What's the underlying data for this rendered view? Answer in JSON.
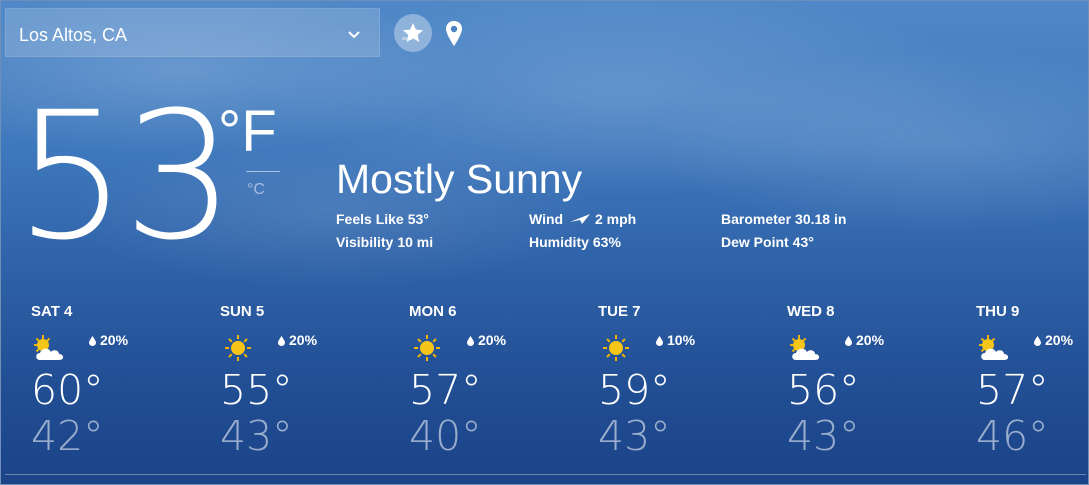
{
  "header": {
    "location": "Los Altos, CA",
    "icons": {
      "dropdown": "chevron-down-icon",
      "favorite": "favorite-star-icon",
      "current_location": "location-pin-icon"
    }
  },
  "current": {
    "temperature": "53",
    "unit_active": "°F",
    "unit_alt": "°C",
    "condition": "Mostly Sunny",
    "feels_like_label": "Feels Like",
    "feels_like_value": "53°",
    "visibility_label": "Visibility",
    "visibility_value": "10 mi",
    "wind_label": "Wind",
    "wind_value": "2 mph",
    "humidity_label": "Humidity",
    "humidity_value": "63%",
    "barometer_label": "Barometer",
    "barometer_value": "30.18 in",
    "dew_point_label": "Dew Point",
    "dew_point_value": "43°"
  },
  "forecast": [
    {
      "day": "SAT 4",
      "icon": "partly-sunny-icon",
      "precip": "20%",
      "high": "60°",
      "low": "42°"
    },
    {
      "day": "SUN 5",
      "icon": "sunny-icon",
      "precip": "20%",
      "high": "55°",
      "low": "43°"
    },
    {
      "day": "MON 6",
      "icon": "sunny-icon",
      "precip": "20%",
      "high": "57°",
      "low": "40°"
    },
    {
      "day": "TUE 7",
      "icon": "sunny-icon",
      "precip": "10%",
      "high": "59°",
      "low": "43°"
    },
    {
      "day": "WED 8",
      "icon": "partly-sunny-icon",
      "precip": "20%",
      "high": "56°",
      "low": "43°"
    },
    {
      "day": "THU 9",
      "icon": "partly-sunny-icon",
      "precip": "20%",
      "high": "57°",
      "low": "46°"
    }
  ],
  "colors": {
    "sun": "#f5c518",
    "sun_ray": "#f1b400",
    "cloud": "#ffffff",
    "sky_top": "#4f88c8",
    "sky_bottom": "#1b4388"
  }
}
